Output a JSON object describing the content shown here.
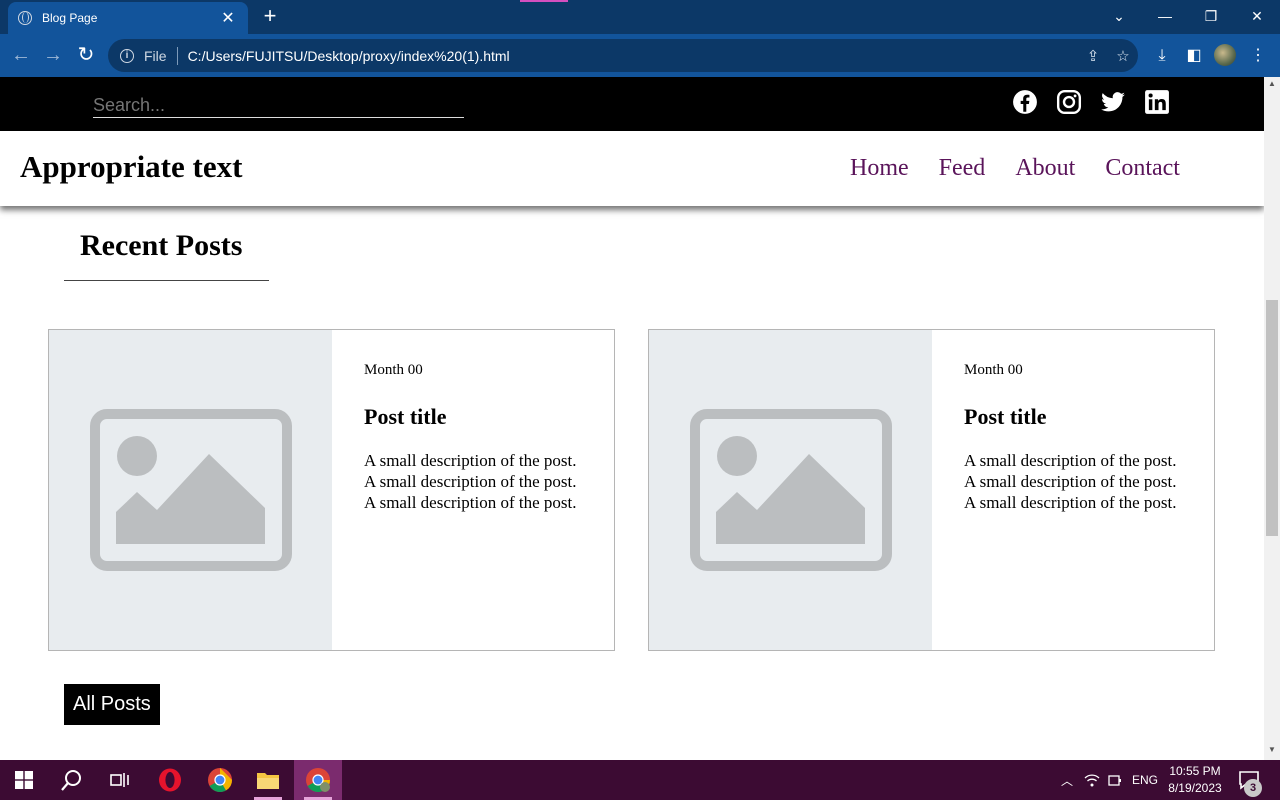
{
  "browser": {
    "tab_title": "Blog Page",
    "omnibox_scheme": "File",
    "url": "C:/Users/FUJITSU/Desktop/proxy/index%20(1).html"
  },
  "site": {
    "search_placeholder": "Search...",
    "brand": "Appropriate text",
    "nav": [
      "Home",
      "Feed",
      "About",
      "Contact"
    ],
    "socials": [
      "facebook-icon",
      "instagram-icon",
      "twitter-icon",
      "linkedin-icon"
    ],
    "nav_color": "#5a145a"
  },
  "main": {
    "section_title": "Recent Posts",
    "posts": [
      {
        "date": "Month 00",
        "title": "Post title",
        "description": "A small description of the post. A small description of the post. A small description of the post."
      },
      {
        "date": "Month 00",
        "title": "Post title",
        "description": "A small description of the post. A small description of the post. A small description of the post."
      }
    ],
    "all_posts_label": "All Posts"
  },
  "taskbar": {
    "language": "ENG",
    "time": "10:55 PM",
    "date": "8/19/2023",
    "notification_count": "3"
  }
}
